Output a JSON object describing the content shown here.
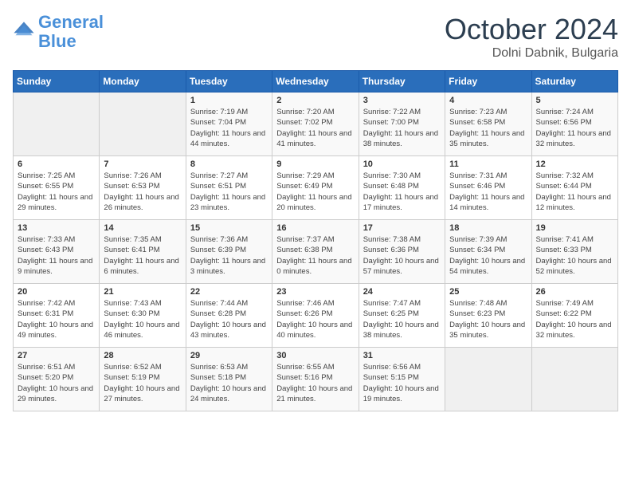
{
  "header": {
    "logo_line1": "General",
    "logo_line2": "Blue",
    "title": "October 2024",
    "subtitle": "Dolni Dabnik, Bulgaria"
  },
  "days_of_week": [
    "Sunday",
    "Monday",
    "Tuesday",
    "Wednesday",
    "Thursday",
    "Friday",
    "Saturday"
  ],
  "weeks": [
    [
      {
        "num": "",
        "info": ""
      },
      {
        "num": "",
        "info": ""
      },
      {
        "num": "1",
        "info": "Sunrise: 7:19 AM\nSunset: 7:04 PM\nDaylight: 11 hours and 44 minutes."
      },
      {
        "num": "2",
        "info": "Sunrise: 7:20 AM\nSunset: 7:02 PM\nDaylight: 11 hours and 41 minutes."
      },
      {
        "num": "3",
        "info": "Sunrise: 7:22 AM\nSunset: 7:00 PM\nDaylight: 11 hours and 38 minutes."
      },
      {
        "num": "4",
        "info": "Sunrise: 7:23 AM\nSunset: 6:58 PM\nDaylight: 11 hours and 35 minutes."
      },
      {
        "num": "5",
        "info": "Sunrise: 7:24 AM\nSunset: 6:56 PM\nDaylight: 11 hours and 32 minutes."
      }
    ],
    [
      {
        "num": "6",
        "info": "Sunrise: 7:25 AM\nSunset: 6:55 PM\nDaylight: 11 hours and 29 minutes."
      },
      {
        "num": "7",
        "info": "Sunrise: 7:26 AM\nSunset: 6:53 PM\nDaylight: 11 hours and 26 minutes."
      },
      {
        "num": "8",
        "info": "Sunrise: 7:27 AM\nSunset: 6:51 PM\nDaylight: 11 hours and 23 minutes."
      },
      {
        "num": "9",
        "info": "Sunrise: 7:29 AM\nSunset: 6:49 PM\nDaylight: 11 hours and 20 minutes."
      },
      {
        "num": "10",
        "info": "Sunrise: 7:30 AM\nSunset: 6:48 PM\nDaylight: 11 hours and 17 minutes."
      },
      {
        "num": "11",
        "info": "Sunrise: 7:31 AM\nSunset: 6:46 PM\nDaylight: 11 hours and 14 minutes."
      },
      {
        "num": "12",
        "info": "Sunrise: 7:32 AM\nSunset: 6:44 PM\nDaylight: 11 hours and 12 minutes."
      }
    ],
    [
      {
        "num": "13",
        "info": "Sunrise: 7:33 AM\nSunset: 6:43 PM\nDaylight: 11 hours and 9 minutes."
      },
      {
        "num": "14",
        "info": "Sunrise: 7:35 AM\nSunset: 6:41 PM\nDaylight: 11 hours and 6 minutes."
      },
      {
        "num": "15",
        "info": "Sunrise: 7:36 AM\nSunset: 6:39 PM\nDaylight: 11 hours and 3 minutes."
      },
      {
        "num": "16",
        "info": "Sunrise: 7:37 AM\nSunset: 6:38 PM\nDaylight: 11 hours and 0 minutes."
      },
      {
        "num": "17",
        "info": "Sunrise: 7:38 AM\nSunset: 6:36 PM\nDaylight: 10 hours and 57 minutes."
      },
      {
        "num": "18",
        "info": "Sunrise: 7:39 AM\nSunset: 6:34 PM\nDaylight: 10 hours and 54 minutes."
      },
      {
        "num": "19",
        "info": "Sunrise: 7:41 AM\nSunset: 6:33 PM\nDaylight: 10 hours and 52 minutes."
      }
    ],
    [
      {
        "num": "20",
        "info": "Sunrise: 7:42 AM\nSunset: 6:31 PM\nDaylight: 10 hours and 49 minutes."
      },
      {
        "num": "21",
        "info": "Sunrise: 7:43 AM\nSunset: 6:30 PM\nDaylight: 10 hours and 46 minutes."
      },
      {
        "num": "22",
        "info": "Sunrise: 7:44 AM\nSunset: 6:28 PM\nDaylight: 10 hours and 43 minutes."
      },
      {
        "num": "23",
        "info": "Sunrise: 7:46 AM\nSunset: 6:26 PM\nDaylight: 10 hours and 40 minutes."
      },
      {
        "num": "24",
        "info": "Sunrise: 7:47 AM\nSunset: 6:25 PM\nDaylight: 10 hours and 38 minutes."
      },
      {
        "num": "25",
        "info": "Sunrise: 7:48 AM\nSunset: 6:23 PM\nDaylight: 10 hours and 35 minutes."
      },
      {
        "num": "26",
        "info": "Sunrise: 7:49 AM\nSunset: 6:22 PM\nDaylight: 10 hours and 32 minutes."
      }
    ],
    [
      {
        "num": "27",
        "info": "Sunrise: 6:51 AM\nSunset: 5:20 PM\nDaylight: 10 hours and 29 minutes."
      },
      {
        "num": "28",
        "info": "Sunrise: 6:52 AM\nSunset: 5:19 PM\nDaylight: 10 hours and 27 minutes."
      },
      {
        "num": "29",
        "info": "Sunrise: 6:53 AM\nSunset: 5:18 PM\nDaylight: 10 hours and 24 minutes."
      },
      {
        "num": "30",
        "info": "Sunrise: 6:55 AM\nSunset: 5:16 PM\nDaylight: 10 hours and 21 minutes."
      },
      {
        "num": "31",
        "info": "Sunrise: 6:56 AM\nSunset: 5:15 PM\nDaylight: 10 hours and 19 minutes."
      },
      {
        "num": "",
        "info": ""
      },
      {
        "num": "",
        "info": ""
      }
    ]
  ]
}
